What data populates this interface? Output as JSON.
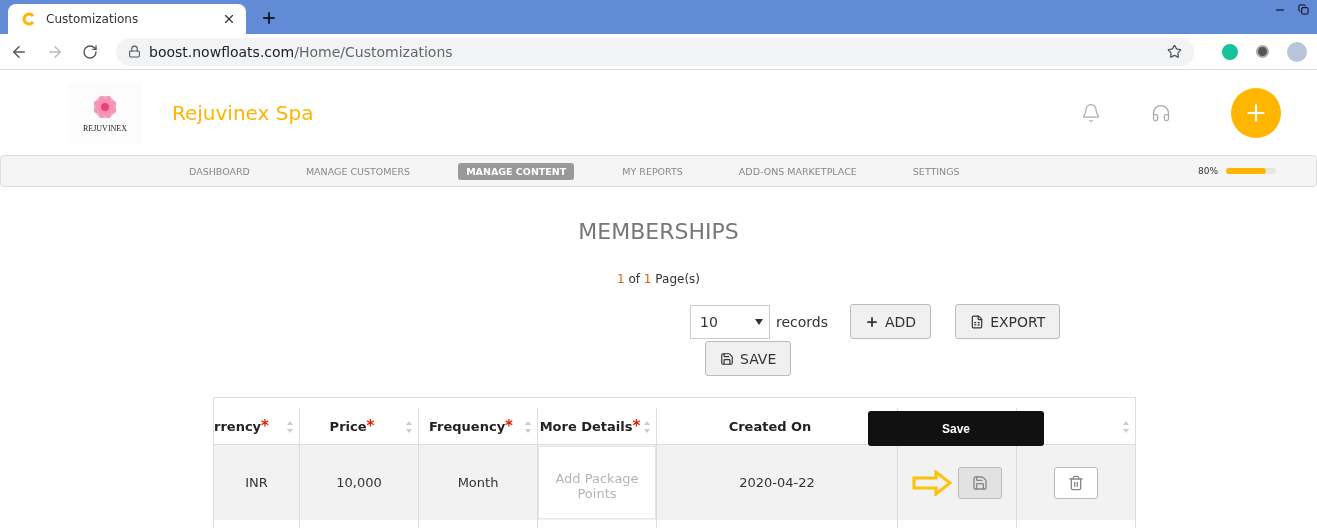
{
  "browser": {
    "tab_title": "Customizations",
    "url_host": "boost.nowfloats.com",
    "url_path": "/Home/Customizations"
  },
  "header": {
    "logo_text": "REJUVINEX",
    "business_name": "Rejuvinex Spa"
  },
  "nav": [
    {
      "label": "DASHBOARD",
      "selected": false
    },
    {
      "label": "MANAGE CUSTOMERS",
      "selected": false
    },
    {
      "label": "MANAGE CONTENT",
      "selected": true
    },
    {
      "label": "MY REPORTS",
      "selected": false
    },
    {
      "label": "ADD-ONS MARKETPLACE",
      "selected": false
    },
    {
      "label": "SETTINGS",
      "selected": false
    }
  ],
  "profile": {
    "reading": "80%",
    "level": 0.8
  },
  "page_title": "MEMBERSHIPS",
  "pager": {
    "current": "1",
    "of": "of",
    "total": "1",
    "suffix": "Page(s)"
  },
  "records": {
    "value": "10",
    "label": "records"
  },
  "buttons": {
    "add": "ADD",
    "export": "EXPORT",
    "save": "SAVE"
  },
  "table": {
    "columns": [
      {
        "label": "rrency",
        "required_mark": "*",
        "sortable": true
      },
      {
        "label": "Price",
        "required_mark": "*",
        "sortable": true
      },
      {
        "label": "Frequency",
        "required_mark": "*",
        "sortable": true
      },
      {
        "label": "More Details",
        "required_mark": "*",
        "sortable": true
      },
      {
        "label": "Created On"
      },
      {},
      {
        "sortable": true
      }
    ],
    "rows": [
      {
        "currency": "INR",
        "price": "10,000",
        "frequency": "Month",
        "details_placeholder": "Add Package Points",
        "created_on": "2020-04-22"
      }
    ]
  },
  "tooltip": "Save"
}
